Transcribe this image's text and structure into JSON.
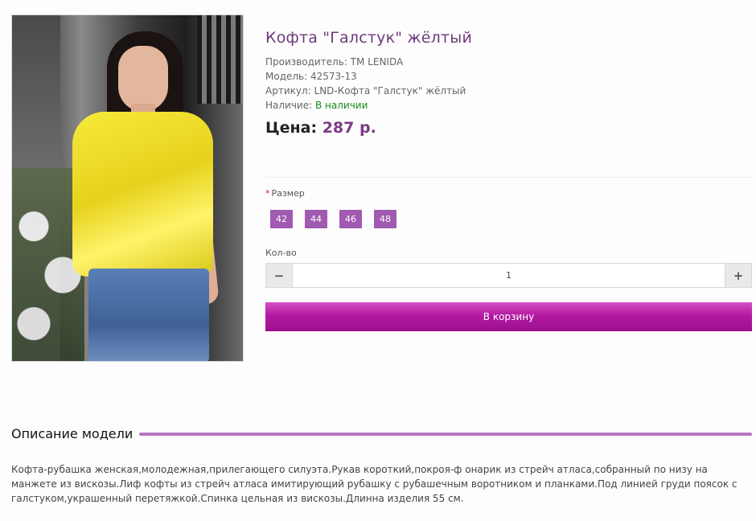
{
  "product": {
    "title": "Кофта \"Галстук\" жёлтый",
    "manufacturer_label": "Производитель:",
    "manufacturer_value": "TM LENIDA",
    "model_label": "Модель:",
    "model_value": "42573-13",
    "sku_label": "Артикул:",
    "sku_value": "LND-Кофта \"Галстук\" жёлтый",
    "availability_label": "Наличие:",
    "availability_value": "В наличии",
    "price_label": "Цена:",
    "price_value": "287 р."
  },
  "options": {
    "required_mark": "*",
    "size_label": "Размер",
    "sizes": [
      "42",
      "44",
      "46",
      "48"
    ]
  },
  "quantity": {
    "label": "Кол-во",
    "value": "1",
    "minus": "−",
    "plus": "+"
  },
  "cart": {
    "button_label": "В корзину"
  },
  "description": {
    "heading": "Описание модели",
    "text": "Кофта-рубашка женская,молодежная,прилегающего силуэта.Рукав короткий,покроя-ф онарик из стрейч атласа,собранный по низу на манжете из вискозы.Лиф кофты из стрейч атласа имитирующий рубашку с рубашечным воротником и планками.Под линией груди поясок с галстуком,украшенный перетяжкой.Спинка цельная из вискозы.Длинна изделия 55 см."
  },
  "colors": {
    "title": "#6d3a7c",
    "accent": "#a05ab0",
    "cart": "#b21aa1",
    "in_stock": "#1b8a1b"
  }
}
